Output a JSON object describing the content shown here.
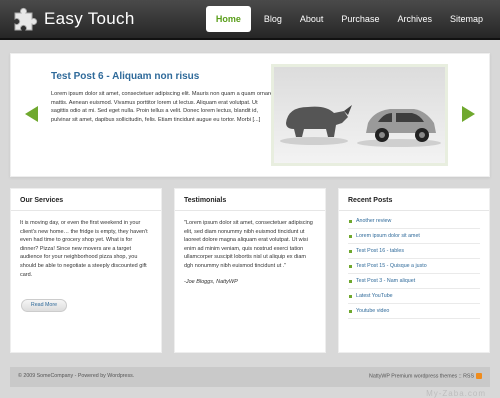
{
  "site": {
    "title": "Easy Touch"
  },
  "nav": [
    "Home",
    "Blog",
    "About",
    "Purchase",
    "Archives",
    "Sitemap"
  ],
  "featured": {
    "title": "Test Post 6 - Aliquam non risus",
    "body": "Lorem ipsum dolor sit amet, consectetuer adipiscing elit. Mauris non quam a quam ornare mattis. Aenean euismod. Vivamus porttitor lorem ut lectus. Aliquam erat volutpat. Ut sagittis odio at mi. Sed eget nulla. Proin tellus a velit. Donec lorem lectus, blandit id, pulvinar sit amet, dapibus sollicitudin, felis. Etiam tincidunt augue eu tortor. Morbi [...]"
  },
  "services": {
    "heading": "Our Services",
    "text": "It is moving day, or even the first weekend in your client's new home… the fridge is empty, they haven't even had time to grocery shop yet. What is for dinner? Pizza! Since new movers are a target audience for your neighborhood pizza shop, you should be able to negotiate a steeply discounted gift card.",
    "button": "Read More"
  },
  "testimonials": {
    "heading": "Testimonials",
    "quote": "\"Lorem ipsum dolor sit amet, consectetuer adipiscing elit, sed diam nonummy nibh euismod tincidunt ut laoreet dolore magna aliquam erat volutpat. Ut wisi enim ad minim veniam, quis nostrud exerci tation ullamcorper suscipit lobortis nisl ut aliquip ex diam dgh nonummy nibh euismod tincidunt ut .\"",
    "author": "-Joe Bloggs, NattyWP"
  },
  "recent": {
    "heading": "Recent Posts",
    "items": [
      "Another review",
      "Lorem ipsum dolor sit amet",
      "Test Post 16 - tables",
      "Test Post 15 - Quisque a justo",
      "Test Post 3 - Nam aliquet",
      "Latest YouTube",
      "Youtube video"
    ]
  },
  "footer": {
    "left": "© 2009 SomeCompany - Powered by Wordpress.",
    "right": "NattyWP Premium wordpress themes :: RSS"
  },
  "watermark": "My-Zaba.com"
}
